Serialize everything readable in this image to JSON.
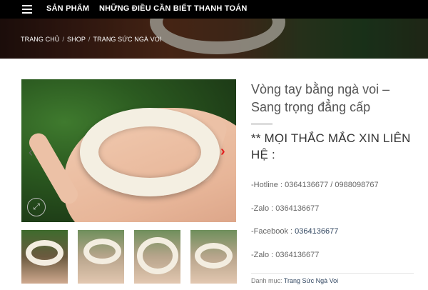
{
  "nav": {
    "items": [
      "SẢN PHẨM",
      "NHỮNG ĐIỀU CẦN BIẾT",
      "THANH TOÁN"
    ]
  },
  "breadcrumb": {
    "home": "TRANG CHỦ",
    "sep1": "/",
    "shop": "SHOP",
    "sep2": "/",
    "category": "TRANG SỨC NGÀ VOI"
  },
  "gallery": {
    "prev_arrow": "‹",
    "next_arrow": "›",
    "zoom_icon": "⤢"
  },
  "product": {
    "title_line1": "Vòng tay bằng ngà voi –",
    "title_line2": "Sang trọng đẳng cấp",
    "notice_line1": "** MỌI THẮC MẮC XIN LIÊN",
    "notice_line2": "HỆ  :",
    "hotline": "-Hotline : 0364136677 / 0988098767",
    "zalo1": "-Zalo  : 0364136677",
    "facebook_label": "-Facebook  : ",
    "facebook_link": "0364136677",
    "zalo2": "-Zalo : 0364136677",
    "category_label": "Danh mục: ",
    "category_link": "Trang Sức Ngà Voi"
  },
  "colors": {
    "nav_bg": "#000000",
    "arrow_accent": "#e21f1f",
    "link": "#334862"
  }
}
